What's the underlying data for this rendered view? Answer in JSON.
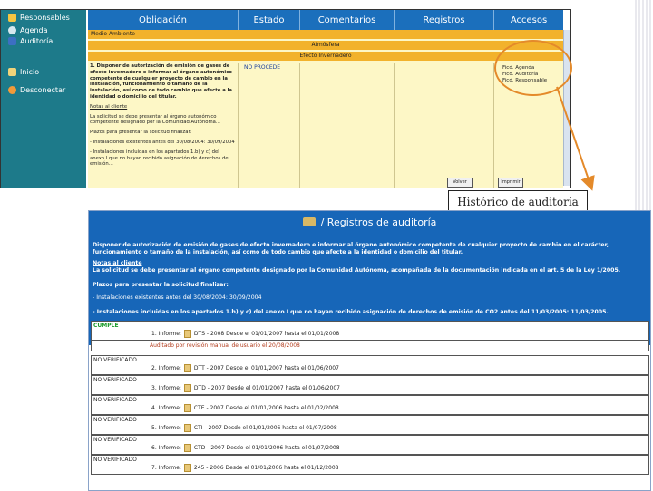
{
  "sidebar": {
    "items": [
      {
        "label": "Responsables",
        "icon": "star-icon"
      },
      {
        "label": "Agenda",
        "icon": "gear-icon"
      },
      {
        "label": "Auditoría",
        "icon": "book-icon"
      },
      {
        "label": "Inicio",
        "icon": "home-icon"
      },
      {
        "label": "Desconectar",
        "icon": "exit-icon"
      }
    ]
  },
  "grid": {
    "headers": [
      "Obligación",
      "Estado",
      "Comentarios",
      "Registros",
      "Accesos"
    ],
    "row_medio": "Medio Ambiente",
    "row_atm": "Atmósfera",
    "row_invern": "Efecto Invernadero",
    "status": "NO PROCEDE",
    "body": [
      "1. Disponer de autorización de emisión de gases de efecto invernadero e informar al órgano autonómico competente de cualquier proyecto de cambio en la instalación, funcionamiento o tamaño de la instalación, así como de todo cambio que afecte a la identidad o domicilio del titular.",
      "Notas al cliente",
      "La solicitud se debe presentar al órgano autonómico competente designado por la Comunidad Autónoma...",
      "Plazos para presentar la solicitud finalizar:",
      "- Instalaciones existentes antes del 30/08/2004: 30/09/2004",
      "- Instalaciones incluidas en los apartados 1.b) y c) del anexo I que no hayan recibido asignación de derechos de emisión..."
    ],
    "access": [
      "Ficd. Agenda",
      "Ficd. Auditoría",
      "Ficd. Responsable"
    ],
    "buttons": [
      "Volver",
      "Imprimir"
    ]
  },
  "callout_label": "Histórico de auditoría",
  "audit": {
    "title": "/ Registros de auditoría",
    "info": [
      "Disponer de autorización de emisión de gases de efecto invernadero e informar al órgano autonómico competente de cualquier proyecto de cambio en el carácter, funcionamiento o tamaño de la instalación, así como de todo cambio que afecte a la identidad o domicilio del titular.",
      "Notas al cliente",
      "La solicitud se debe presentar al órgano competente designado por la Comunidad Autónoma, acompañada de la documentación indicada en el art. 5 de la Ley 1/2005.",
      "Plazos para presentar la solicitud finalizar:",
      "- Instalaciones existentes antes del 30/08/2004: 30/09/2004",
      "- Instalaciones incluidas en los apartados 1.b) y c) del anexo I que no hayan recibido asignación de derechos de emisión de CO2 antes del 11/03/2005: 11/03/2005."
    ],
    "rows": [
      {
        "status": "CUMPLE",
        "report": "1. Informe:",
        "text": "DTS - 2008 Desde el 01/01/2007 hasta el 01/01/2008",
        "sub": "Auditado por revisión manual de usuario el 20/08/2008"
      },
      {
        "status": "NO VERIFICADO",
        "report": "2. Informe:",
        "text": "DTT - 2007 Desde el 01/01/2007 hasta el 01/06/2007"
      },
      {
        "status": "NO VERIFICADO",
        "report": "3. Informe:",
        "text": "DTD - 2007 Desde el 01/01/2007 hasta el 01/06/2007"
      },
      {
        "status": "NO VERIFICADO",
        "report": "4. Informe:",
        "text": "CTE - 2007 Desde el 01/01/2006 hasta el 01/02/2008"
      },
      {
        "status": "NO VERIFICADO",
        "report": "5. Informe:",
        "text": "CTI - 2007 Desde el 01/01/2006 hasta el 01/07/2008"
      },
      {
        "status": "NO VERIFICADO",
        "report": "6. Informe:",
        "text": "CTD - 2007 Desde el 01/01/2006 hasta el 01/07/2008"
      },
      {
        "status": "NO VERIFICADO",
        "report": "7. Informe:",
        "text": "245 - 2006 Desde el 01/01/2006 hasta el 01/12/2008"
      }
    ]
  },
  "colors": {
    "sidebar": "#1d7a8a",
    "header": "#1b6fbc",
    "yellow_row": "#f2b22c",
    "body": "#fdf7c6",
    "audit_bg": "#1766b8",
    "callout": "#e48a2a"
  }
}
